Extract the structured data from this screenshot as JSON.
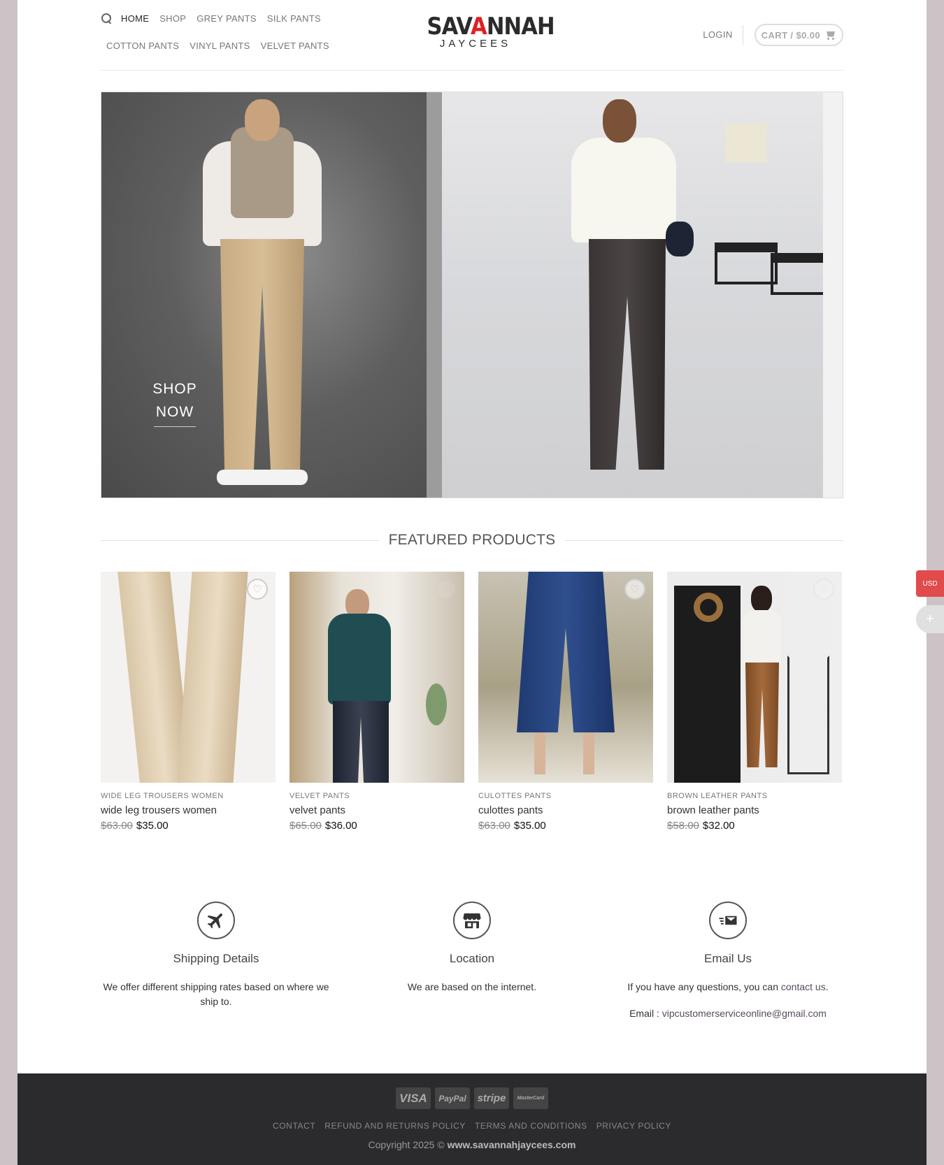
{
  "header": {
    "nav_row1": [
      "HOME",
      "SHOP",
      "GREY PANTS",
      "SILK PANTS"
    ],
    "nav_row2": [
      "COTTON PANTS",
      "VINYL PANTS",
      "VELVET PANTS"
    ],
    "logo_main_a": "SAV",
    "logo_main_b": "A",
    "logo_main_c": "NNAH",
    "logo_sub": "JAYCEES",
    "login": "LOGIN",
    "cart": "CART / $0.00"
  },
  "hero": {
    "cta_line1": "SHOP",
    "cta_line2": "NOW"
  },
  "featured": {
    "title": "FEATURED PRODUCTS",
    "products": [
      {
        "category": "WIDE LEG TROUSERS WOMEN",
        "name": "wide leg trousers women",
        "old_price": "$63.00",
        "price": "$35.00"
      },
      {
        "category": "VELVET PANTS",
        "name": "velvet pants",
        "old_price": "$65.00",
        "price": "$36.00"
      },
      {
        "category": "CULOTTES PANTS",
        "name": "culottes pants",
        "old_price": "$63.00",
        "price": "$35.00"
      },
      {
        "category": "BROWN LEATHER PANTS",
        "name": "brown leather pants",
        "old_price": "$58.00",
        "price": "$32.00"
      }
    ]
  },
  "info": {
    "shipping": {
      "icon": "airplane-icon",
      "title": "Shipping Details",
      "text": "We offer different shipping rates based on where we ship to."
    },
    "location": {
      "icon": "store-icon",
      "title": "Location",
      "text": "We are based on the internet."
    },
    "email": {
      "icon": "mail-icon",
      "title": "Email Us",
      "text_prefix": "If you have any questions, you can ",
      "link": "contact us",
      "text_suffix": ".",
      "email_label": "Email : ",
      "email": "vipcustomerserviceonline@gmail.com"
    }
  },
  "footer": {
    "payments": [
      "VISA",
      "PayPal",
      "stripe",
      "MasterCard"
    ],
    "links": [
      "CONTACT",
      "REFUND AND RETURNS POLICY",
      "TERMS AND CONDITIONS",
      "PRIVACY POLICY"
    ],
    "copyright_prefix": "Copyright 2025 © ",
    "copyright_site": "www.savannahjaycees.com"
  },
  "widgets": {
    "currency": "USD"
  },
  "colors": {
    "accent_red": "#e02020",
    "footer_bg": "#2b2b2d",
    "currency_badge": "#e14b4b"
  }
}
